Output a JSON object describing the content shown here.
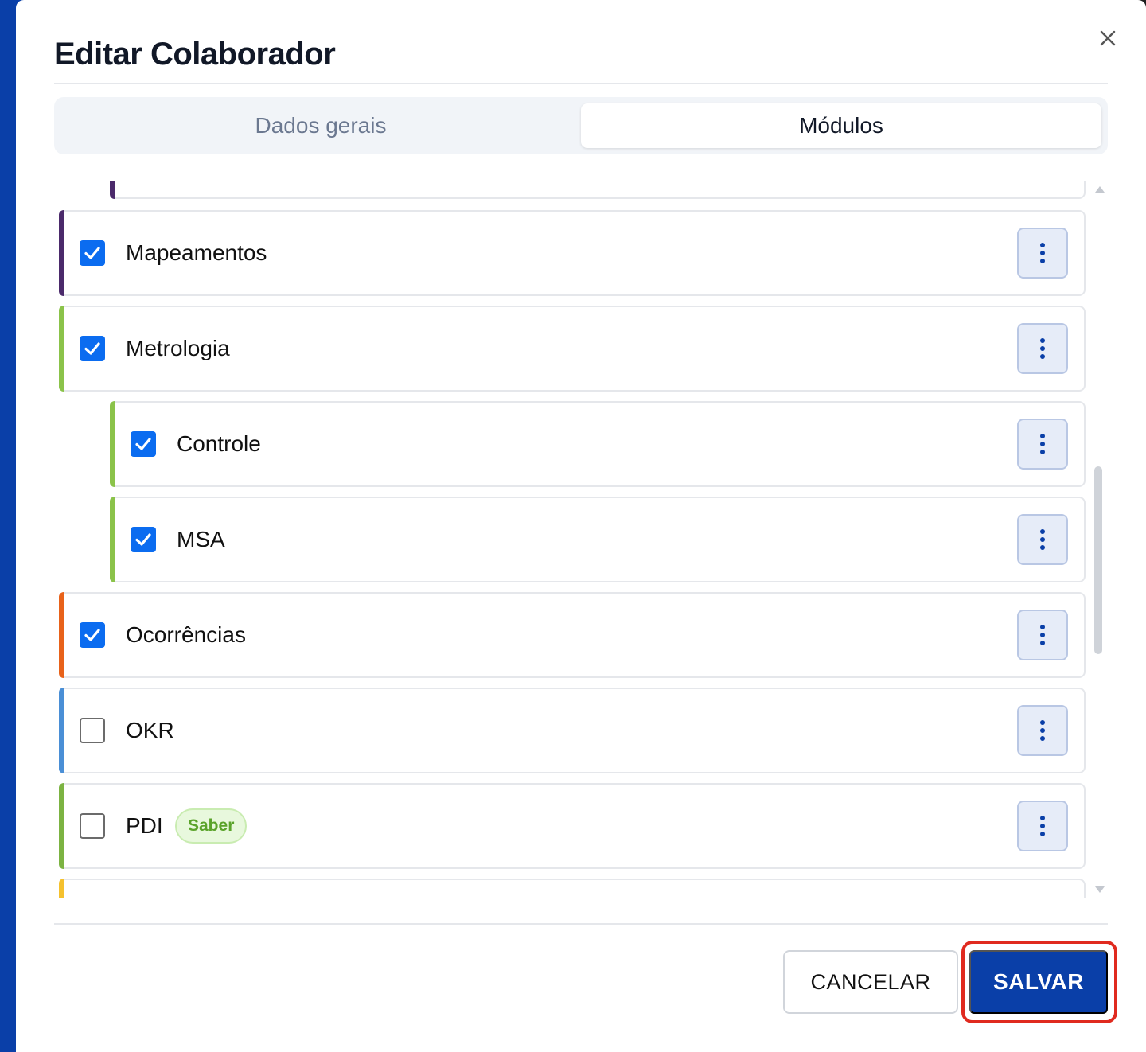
{
  "dialog": {
    "title": "Editar Colaborador",
    "close_icon": "close-icon"
  },
  "tabs": [
    {
      "label": "Dados gerais",
      "active": false
    },
    {
      "label": "Módulos",
      "active": true
    }
  ],
  "modules": [
    {
      "label": "",
      "checked": true,
      "accent": "#4b2a6b",
      "partial": "top"
    },
    {
      "label": "Mapeamentos",
      "checked": true,
      "accent": "#4b2a6b"
    },
    {
      "label": "Metrologia",
      "checked": true,
      "accent": "#8bc34a"
    },
    {
      "label": "Controle",
      "checked": true,
      "accent": "#8bc34a",
      "child": true
    },
    {
      "label": "MSA",
      "checked": true,
      "accent": "#8bc34a",
      "child": true
    },
    {
      "label": "Ocorrências",
      "checked": true,
      "accent": "#e8621a"
    },
    {
      "label": "OKR",
      "checked": false,
      "accent": "#4a8fd6"
    },
    {
      "label": "PDI",
      "checked": false,
      "accent": "#7cb342",
      "badge": "Saber"
    },
    {
      "label": "",
      "checked": false,
      "accent": "#f5c12e",
      "partial": "bottom"
    }
  ],
  "footer": {
    "cancel_label": "CANCELAR",
    "save_label": "SALVAR"
  },
  "colors": {
    "primary": "#0a3fa8",
    "checkbox": "#0b6cf0",
    "highlight": "#e02a1f",
    "badge_text": "#5aa32a"
  }
}
